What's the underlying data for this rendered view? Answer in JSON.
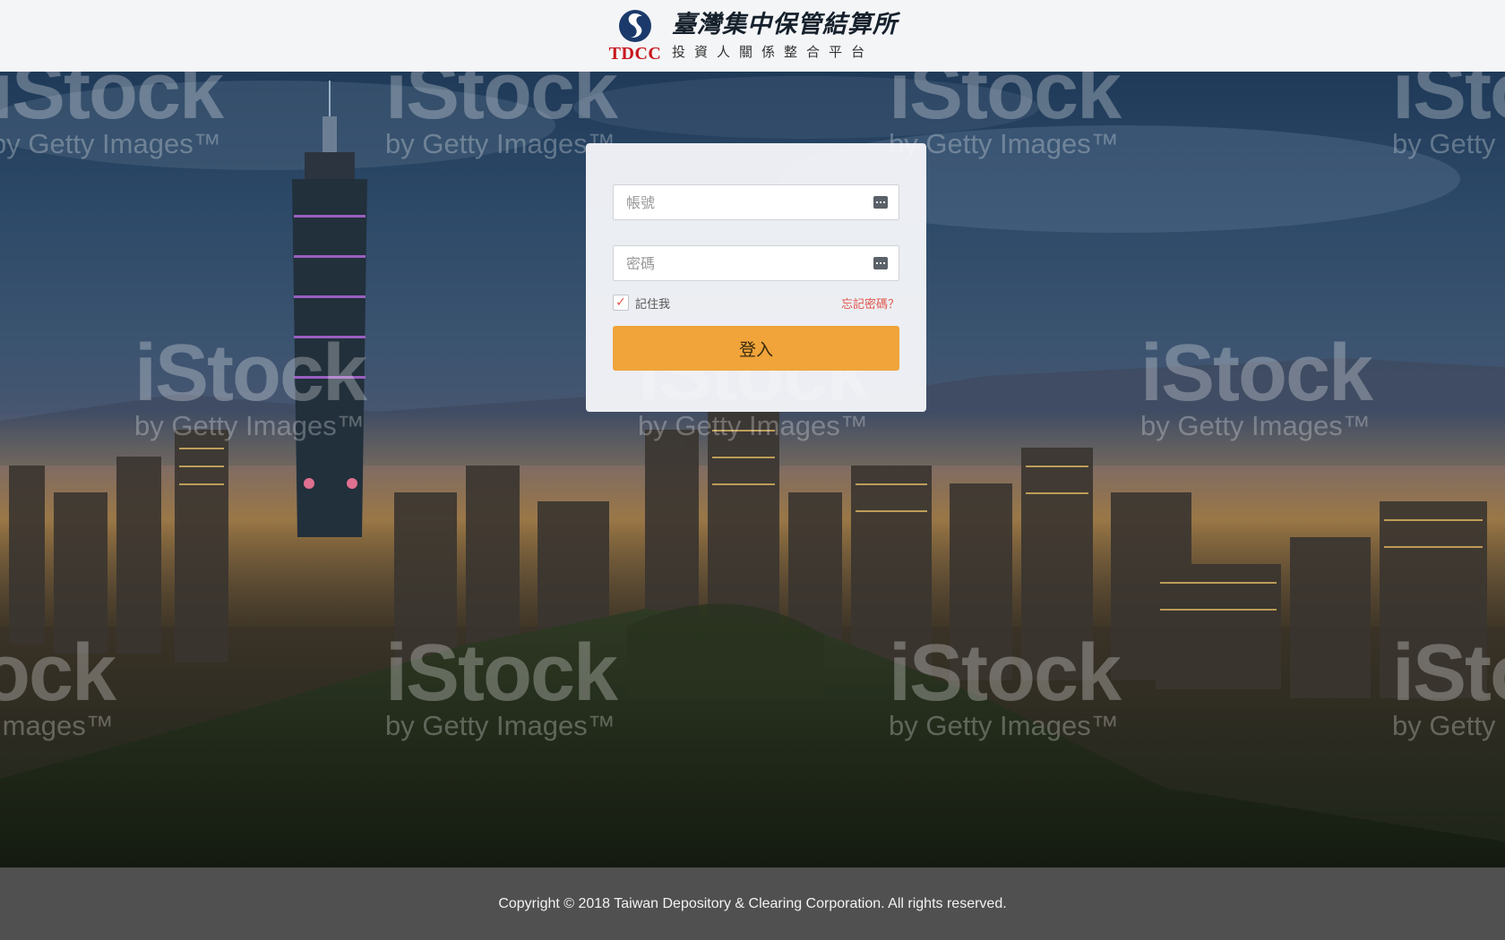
{
  "header": {
    "logo_title": "臺灣集中保管結算所",
    "logo_abbr": "TDCC",
    "logo_subtitle": "投資人關係整合平台"
  },
  "background": {
    "watermark_big": "iStock",
    "watermark_small": "by Getty Images™"
  },
  "login": {
    "account_placeholder": "帳號",
    "password_placeholder": "密碼",
    "remember_label": "記住我",
    "remember_checked": true,
    "forgot_label": "忘記密碼？",
    "submit_label": "登入"
  },
  "footer": {
    "copyright": "Copyright © 2018 Taiwan Depository & Clearing Corporation. All rights reserved."
  },
  "colors": {
    "accent_button": "#f0a43a",
    "link_red": "#e2574c",
    "header_bg": "#f4f5f7",
    "footer_bg": "#505050",
    "brand_blue": "#1b3a6b",
    "brand_red": "#c8161d"
  }
}
